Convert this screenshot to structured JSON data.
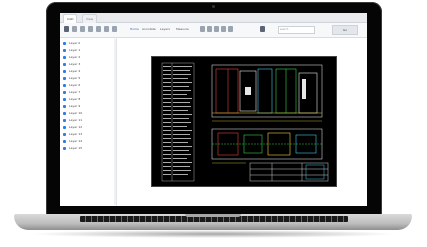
{
  "tabs": [
    "CAD",
    "View"
  ],
  "toolbar": {
    "menus": [
      "Home",
      "Annotate",
      "Layers",
      "Measure"
    ],
    "search_placeholder": "search",
    "button_label": "Go"
  },
  "sidebar": {
    "items": [
      "Layer 0",
      "Layer 1",
      "Layer 2",
      "Layer 3",
      "Layer 4",
      "Layer 5",
      "Layer 6",
      "Layer 7",
      "Layer 8",
      "Layer 9",
      "Layer 10",
      "Layer 11",
      "Layer 12",
      "Layer 13",
      "Layer 14",
      "Layer 15"
    ]
  },
  "colors": {
    "accent": "#2f7de1",
    "drawing_bg": "#000000",
    "line_white": "#e6e6e6",
    "line_red": "#e0403a",
    "line_green": "#36d34a",
    "line_yellow": "#e8d23a",
    "line_cyan": "#44c9e8"
  }
}
